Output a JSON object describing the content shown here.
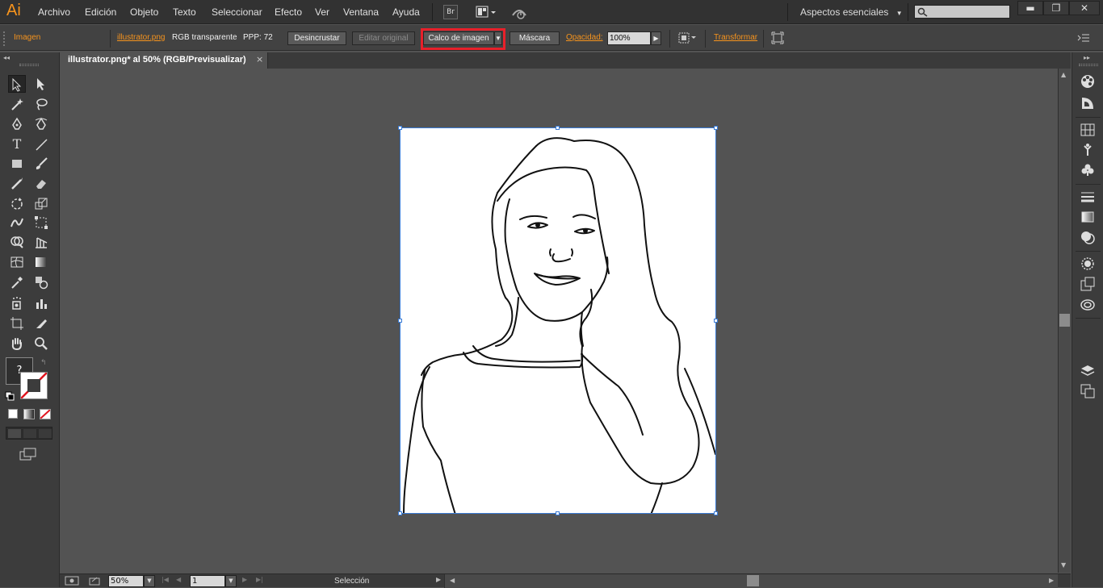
{
  "menubar": {
    "logo": "Ai",
    "items": [
      "Archivo",
      "Edición",
      "Objeto",
      "Texto",
      "Seleccionar",
      "Efecto",
      "Ver",
      "Ventana",
      "Ayuda"
    ],
    "bridge_label": "Br",
    "workspace": "Aspectos esenciales",
    "search_placeholder": ""
  },
  "controlbar": {
    "selection_type": "Imagen",
    "file_link": "illustrator.png",
    "color_mode": "RGB transparente",
    "ppi": "PPP: 72",
    "unembed_button": "Desincrustar",
    "edit_original_button": "Editar original",
    "trace_button": "Calco de imagen",
    "mask_button": "Máscara",
    "opacity_label": "Opacidad:",
    "opacity_value": "100%",
    "transform_link": "Transformar"
  },
  "document": {
    "tab_title": "illustrator.png* al 50% (RGB/Previsualizar)",
    "close_glyph": "×"
  },
  "toolpanel": {
    "fill_unknown": "?"
  },
  "statusbar": {
    "zoom": "50%",
    "artboard_number": "1",
    "tool_status": "Selección"
  }
}
